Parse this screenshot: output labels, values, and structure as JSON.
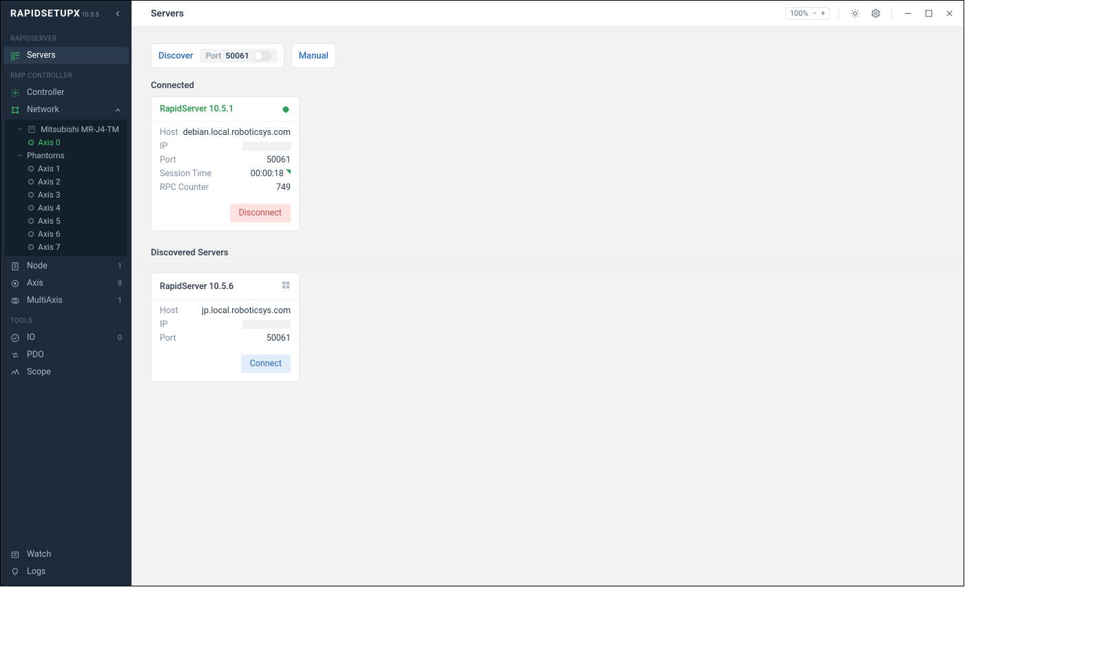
{
  "app": {
    "name": "RAPIDSETUPX",
    "version": "10.5.5"
  },
  "titlebar": {
    "title": "Servers",
    "zoom": "100%"
  },
  "sidebar": {
    "sections": {
      "rapidserver": "RAPIDSERVER",
      "rmp": "RMP CONTROLLER",
      "tools": "TOOLS"
    },
    "items": {
      "servers": "Servers",
      "controller": "Controller",
      "network": "Network",
      "node": {
        "label": "Node",
        "count": "1"
      },
      "axis": {
        "label": "Axis",
        "count": "8"
      },
      "multiaxis": {
        "label": "MultiAxis",
        "count": "1"
      },
      "io": {
        "label": "IO",
        "count": "0"
      },
      "pdo": "PDO",
      "scope": "Scope",
      "watch": "Watch",
      "logs": "Logs"
    },
    "tree": {
      "device": "Mitsubishi MR-J4-TM",
      "axis0": "Axis 0",
      "phantoms": "Phantoms",
      "axes": [
        "Axis 1",
        "Axis 2",
        "Axis 3",
        "Axis 4",
        "Axis 5",
        "Axis 6",
        "Axis 7"
      ]
    }
  },
  "mode": {
    "discover": "Discover",
    "portLabel": "Port",
    "portValue": "50061",
    "manual": "Manual"
  },
  "connected": {
    "heading": "Connected",
    "card": {
      "title": "RapidServer 10.5.1",
      "host": "debian.local.roboticsys.com",
      "port": "50061",
      "sessionTime": "00:00:18",
      "rpcCounter": "749",
      "labels": {
        "host": "Host",
        "ip": "IP",
        "port": "Port",
        "session": "Session Time",
        "rpc": "RPC Counter"
      },
      "button": "Disconnect"
    }
  },
  "discovered": {
    "heading": "Discovered Servers",
    "card": {
      "title": "RapidServer 10.5.6",
      "host": "jp.local.roboticsys.com",
      "port": "50061",
      "labels": {
        "host": "Host",
        "ip": "IP",
        "port": "Port"
      },
      "button": "Connect"
    }
  }
}
